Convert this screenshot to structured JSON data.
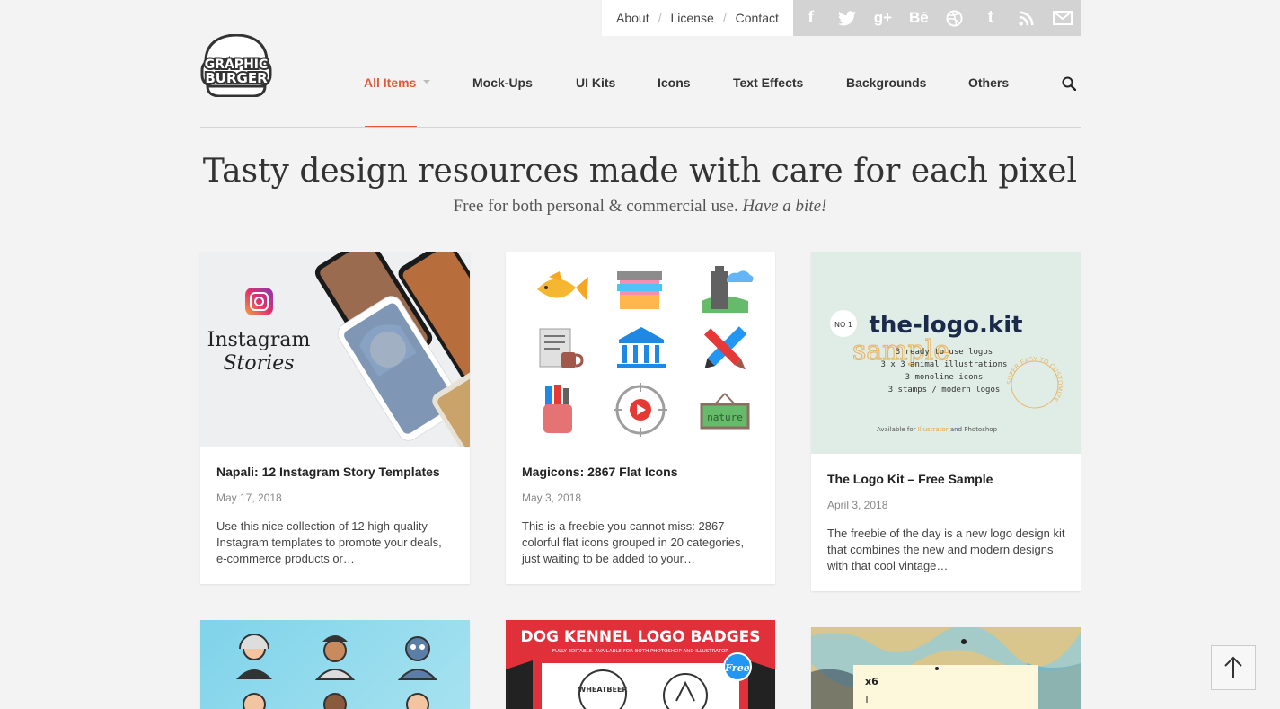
{
  "top_links": {
    "about": "About",
    "license": "License",
    "contact": "Contact",
    "separator": "/"
  },
  "social_icons": [
    "facebook-icon",
    "twitter-icon",
    "google-plus-icon",
    "behance-icon",
    "dribbble-icon",
    "tumblr-icon",
    "rss-icon",
    "email-icon"
  ],
  "social_glyphs": {
    "facebook": "f",
    "google_plus": "g+",
    "behance": "Bē",
    "tumblr": "t"
  },
  "logo": {
    "line1": "GRAPHIC",
    "line2": "BURGER"
  },
  "nav": {
    "items": [
      "All Items",
      "Mock-Ups",
      "UI Kits",
      "Icons",
      "Text Effects",
      "Backgrounds",
      "Others"
    ],
    "active": "All Items"
  },
  "hero": {
    "title": "Tasty design resources made with care for each pixel",
    "subtitle": "Free for both personal & commercial use.",
    "subtitle_em": "Have a bite!"
  },
  "cards": [
    {
      "title": "Napali: 12 Instagram Story Templates",
      "date": "May 17, 2018",
      "desc": "Use this nice collection of 12 high-quality Instagram templates to promote your deals, e-commerce products or…",
      "thumb_text1": "Instagram",
      "thumb_text2": "Stories"
    },
    {
      "title": "Magicons: 2867 Flat Icons",
      "date": "May 3, 2018",
      "desc": "This is a freebie you cannot miss: 2867 colorful flat icons grouped in 20 categories, just waiting to be added to your…",
      "thumb_sign": "nature"
    },
    {
      "title": "The Logo Kit – Free Sample",
      "date": "April 3, 2018",
      "desc": "The freebie of the day is a new logo design kit that combines the new and modern designs with that cool vintage…",
      "thumb_badge": "NO 1",
      "thumb_brand": "the-logo.kit",
      "thumb_sample": "sample",
      "thumb_lines": [
        "3 ready to use logos",
        "3 x 3 animal illustrations",
        "3 monoline icons",
        "3 stamps / modern logos"
      ],
      "thumb_avail_prefix": "Available for",
      "thumb_avail_a": "Illustrator",
      "thumb_avail_mid": "and",
      "thumb_avail_b": "Photoshop",
      "thumb_ring": "SUPER EASY TO CUSTOMIZE"
    },
    {
      "thumb_theme": "avatars"
    },
    {
      "thumb_title": "DOG KENNEL LOGO BADGES",
      "thumb_sub": "FULLY EDITABLE. AVAILABLE FOR BOTH PHOTOSHOP AND ILLUSTRATOR",
      "thumb_badge": "Free",
      "thumb_stamp": "WHEATBEER"
    },
    {
      "thumb_label": "x6"
    }
  ],
  "colors": {
    "accent": "#e05a3a",
    "social_bg": "#d3d3d3",
    "page_bg": "#f3f3f3"
  }
}
